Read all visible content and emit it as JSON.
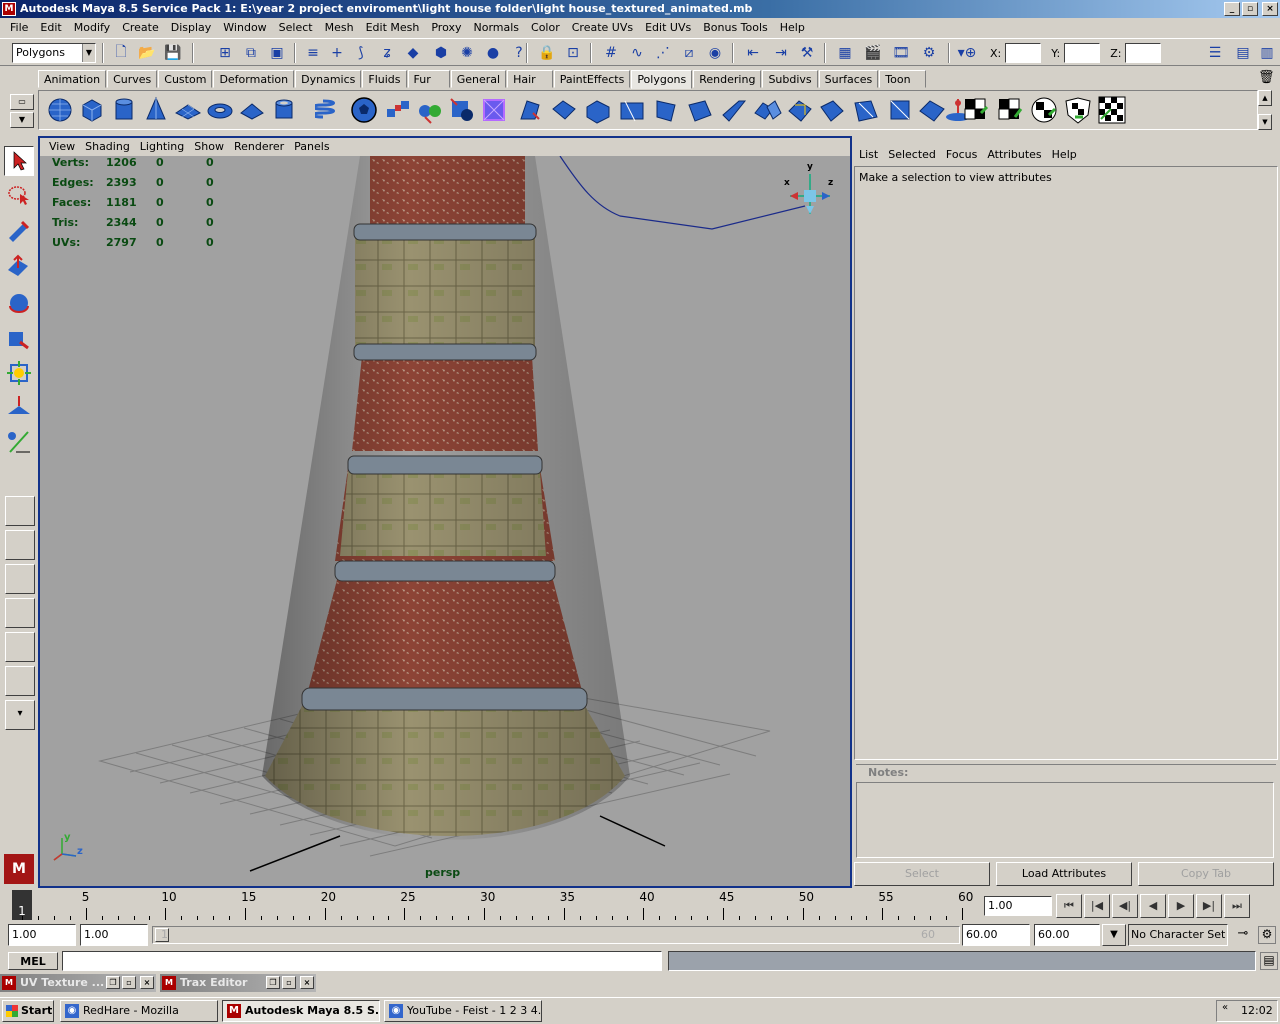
{
  "window": {
    "title": "Autodesk Maya 8.5 Service Pack 1: E:\\year 2 project enviroment\\light house folder\\light house_textured_animated.mb",
    "controls": {
      "minimize": "_",
      "maximize": "▫",
      "close": "×"
    }
  },
  "menubar": [
    "File",
    "Edit",
    "Modify",
    "Create",
    "Display",
    "Window",
    "Select",
    "Mesh",
    "Edit Mesh",
    "Proxy",
    "Normals",
    "Color",
    "Create UVs",
    "Edit UVs",
    "Bonus Tools",
    "Help"
  ],
  "status_line": {
    "menu_set": "Polygons",
    "x_label": "X:",
    "y_label": "Y:",
    "z_label": "Z:"
  },
  "shelf": {
    "tabs": [
      "Animation",
      "Curves",
      "Custom",
      "Deformation",
      "Dynamics",
      "Fluids",
      "Fur",
      "General",
      "Hair",
      "PaintEffects",
      "Polygons",
      "Rendering",
      "Subdivs",
      "Surfaces",
      "Toon"
    ],
    "active_tab": "Polygons"
  },
  "viewport": {
    "panel_menu": [
      "View",
      "Shading",
      "Lighting",
      "Show",
      "Renderer",
      "Panels"
    ],
    "hud": [
      {
        "label": "Verts:",
        "values": [
          "1206",
          "0",
          "0"
        ]
      },
      {
        "label": "Edges:",
        "values": [
          "2393",
          "0",
          "0"
        ]
      },
      {
        "label": "Faces:",
        "values": [
          "1181",
          "0",
          "0"
        ]
      },
      {
        "label": "Tris:",
        "values": [
          "2344",
          "0",
          "0"
        ]
      },
      {
        "label": "UVs:",
        "values": [
          "2797",
          "0",
          "0"
        ]
      }
    ],
    "camera_name": "persp",
    "axis_labels": {
      "x": "x",
      "y": "y",
      "z": "z"
    }
  },
  "attribute_editor": {
    "menu": [
      "List",
      "Selected",
      "Focus",
      "Attributes",
      "Help"
    ],
    "message": "Make a selection to view attributes",
    "notes_label": "Notes:",
    "buttons": {
      "select": "Select",
      "load": "Load Attributes",
      "copy": "Copy Tab"
    }
  },
  "time_slider": {
    "ticks": [
      "5",
      "10",
      "15",
      "20",
      "25",
      "30",
      "35",
      "40",
      "45",
      "50",
      "55",
      "60"
    ],
    "current": "1",
    "current_field": "1.00",
    "play_controls": [
      "⏮",
      "|◀",
      "◀|",
      "◀",
      "▶",
      "▶|",
      "⏭"
    ]
  },
  "range_slider": {
    "start_time": "1.00",
    "range_start": "1.00",
    "range_start_marker": "1",
    "range_end_marker": "60",
    "range_end": "60.00",
    "end_time": "60.00",
    "character_set": "No Character Set"
  },
  "command_line": {
    "label": "MEL"
  },
  "mini_windows": [
    {
      "title": "UV Texture ..."
    },
    {
      "title": "Trax Editor"
    }
  ],
  "taskbar": {
    "start": "Start",
    "tasks": [
      {
        "label": "RedHare - Mozilla",
        "active": false
      },
      {
        "label": "Autodesk Maya 8.5 S...",
        "active": true
      },
      {
        "label": "YouTube - Feist - 1 2 3 4...",
        "active": false
      }
    ],
    "tray_arrow": "«",
    "clock": "12:02"
  }
}
